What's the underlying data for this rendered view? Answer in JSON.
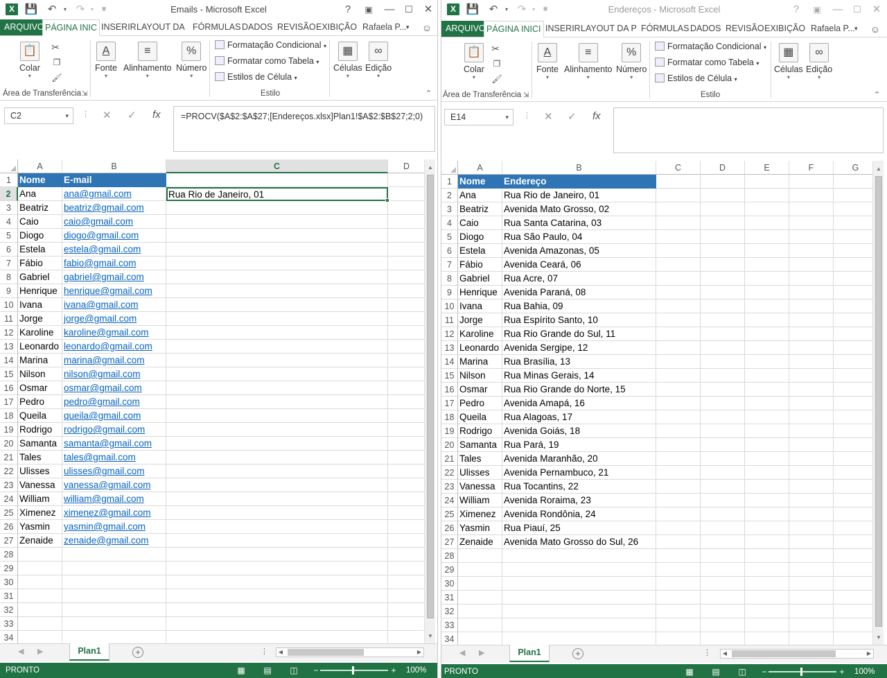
{
  "left": {
    "title": "Emails - Microsoft Excel",
    "tabs": [
      "ARQUIVO",
      "PÁGINA INIC",
      "INSERIR",
      "LAYOUT DA",
      "FÓRMULAS",
      "DADOS",
      "REVISÃO",
      "EXIBIÇÃO"
    ],
    "user": "Rafaela P...",
    "name_box": "C2",
    "formula": "=PROCV($A$2:$A$27;[Endereços.xlsx]Plan1!$A$2:$B$27;2;0)",
    "columns": [
      "A",
      "B",
      "C",
      "D"
    ],
    "headers": [
      "Nome",
      "E-mail"
    ],
    "c2_value": "Rua Rio de Janeiro, 01",
    "sheet": "Plan1",
    "status": "PRONTO",
    "zoom": "100%",
    "rows_max": 34
  },
  "right": {
    "title": "Endereços - Microsoft Excel",
    "tabs": [
      "ARQUIVO",
      "PÁGINA INICI",
      "INSERIR",
      "LAYOUT DA P",
      "FÓRMULAS",
      "DADOS",
      "REVISÃO",
      "EXIBIÇÃO"
    ],
    "user": "Rafaela P...",
    "name_box": "E14",
    "formula": "",
    "columns": [
      "A",
      "B",
      "C",
      "D",
      "E",
      "F",
      "G"
    ],
    "headers": [
      "Nome",
      "Endereço"
    ],
    "sheet": "Plan1",
    "status": "PRONTO",
    "zoom": "100%",
    "rows_max": 34
  },
  "ribbon": {
    "colar": "Colar",
    "fonte": "Fonte",
    "alinhamento": "Alinhamento",
    "numero": "Número",
    "formatacao": "Formatação Condicional",
    "formatar_tabela": "Formatar como Tabela",
    "estilos_celula": "Estilos de Célula",
    "celulas": "Células",
    "edicao": "Edição",
    "area_transf": "Área de Transferência",
    "estilo": "Estilo",
    "percent": "%"
  },
  "names": [
    "Ana",
    "Beatriz",
    "Caio",
    "Diogo",
    "Estela",
    "Fábio",
    "Gabriel",
    "Henrique",
    "Ivana",
    "Jorge",
    "Karoline",
    "Leonardo",
    "Marina",
    "Nilson",
    "Osmar",
    "Pedro",
    "Queila",
    "Rodrigo",
    "Samanta",
    "Tales",
    "Ulisses",
    "Vanessa",
    "William",
    "Ximenez",
    "Yasmin",
    "Zenaide"
  ],
  "emails": [
    "ana@gmail.com",
    "beatriz@gmail.com",
    "caio@gmail.com",
    "diogo@gmail.com",
    "estela@gmail.com",
    "fabio@gmail.com",
    "gabriel@gmail.com",
    "henrique@gmail.com",
    "ivana@gmail.com",
    "jorge@gmail.com",
    "karoline@gmail.com",
    "leonardo@gmail.com",
    "marina@gmail.com",
    "nilson@gmail.com",
    "osmar@gmail.com",
    "pedro@gmail.com",
    "queila@gmail.com",
    "rodrigo@gmail.com",
    "samanta@gmail.com",
    "tales@gmail.com",
    "ulisses@gmail.com",
    "vanessa@gmail.com",
    "william@gmail.com",
    "ximenez@gmail.com",
    "yasmin@gmail.com",
    "zenaide@gmail.com"
  ],
  "addresses": [
    "Rua Rio de Janeiro, 01",
    "Avenida Mato Grosso, 02",
    "Rua Santa Catarina, 03",
    "Rua São Paulo, 04",
    "Avenida Amazonas, 05",
    "Avenida Ceará, 06",
    "Rua Acre, 07",
    "Avenida Paraná, 08",
    "Rua Bahia, 09",
    "Rua Espírito Santo, 10",
    "Rua Rio Grande do Sul, 11",
    "Avenida Sergipe, 12",
    "Rua Brasília, 13",
    "Rua Minas Gerais, 14",
    "Rua Rio Grande do Norte, 15",
    "Avenida Amapá, 16",
    "Rua Alagoas, 17",
    "Avenida Goiás, 18",
    "Rua Pará, 19",
    "Avenida Maranhão, 20",
    "Avenida Pernambuco, 21",
    "Rua Tocantins, 22",
    "Avenida Roraima, 23",
    "Avenida Rondônia, 24",
    "Rua Piauí, 25",
    "Avenida Mato Grosso do Sul, 26"
  ]
}
